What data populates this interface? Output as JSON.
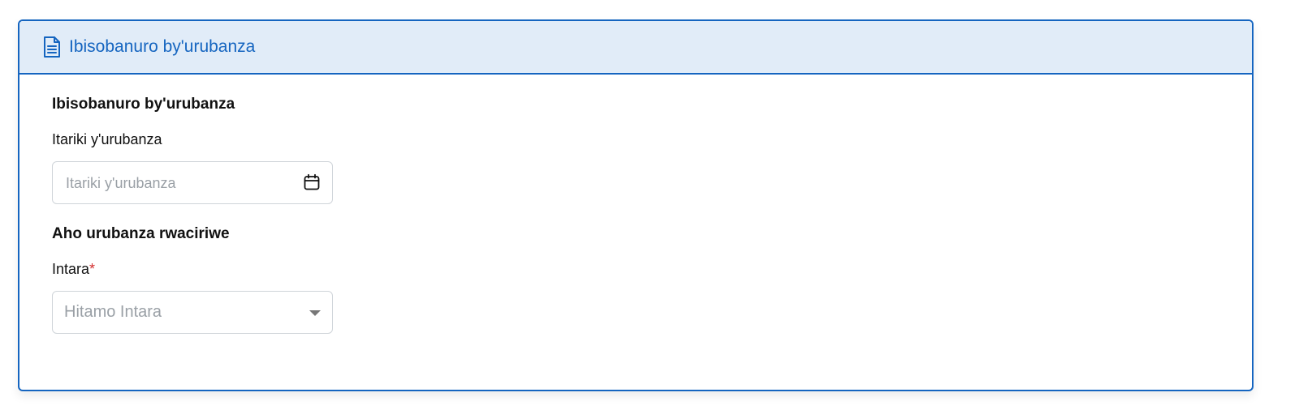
{
  "card": {
    "header_title": "Ibisobanuro by'urubanza",
    "header_icon": "document-icon",
    "accent_color": "#1565c0",
    "header_bg": "#e1ecf8"
  },
  "details_section": {
    "title": "Ibisobanuro by'urubanza",
    "date_field": {
      "label": "Itariki y'urubanza",
      "placeholder": "Itariki y'urubanza",
      "value": "",
      "icon": "calendar-icon"
    }
  },
  "location_section": {
    "title": "Aho urubanza rwaciriwe",
    "province_field": {
      "label": "Intara",
      "required_mark": "*",
      "placeholder": "Hitamo Intara",
      "icon": "chevron-down-icon"
    }
  }
}
